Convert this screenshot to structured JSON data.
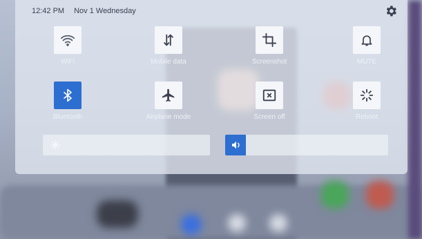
{
  "status": {
    "time": "12:42 PM",
    "date": "Nov 1 Wednesday"
  },
  "tiles": [
    {
      "label": "WiFi",
      "icon": "wifi-icon",
      "active": false
    },
    {
      "label": "Mobile data",
      "icon": "mobile-data-icon",
      "active": false
    },
    {
      "label": "Screenshot",
      "icon": "screenshot-icon",
      "active": false
    },
    {
      "label": "MUTE",
      "icon": "bell-icon",
      "active": false
    },
    {
      "label": "Bluetooth",
      "icon": "bluetooth-icon",
      "active": true
    },
    {
      "label": "Airplane mode",
      "icon": "airplane-icon",
      "active": false
    },
    {
      "label": "Screen off",
      "icon": "screen-off-icon",
      "active": false
    },
    {
      "label": "Reboot",
      "icon": "reboot-icon",
      "active": false
    }
  ],
  "sliders": {
    "brightness": {
      "icon": "brightness-icon",
      "level": 0.0
    },
    "volume": {
      "icon": "volume-icon",
      "level": 0.0
    }
  },
  "colors": {
    "accent": "#2d6ed1"
  }
}
